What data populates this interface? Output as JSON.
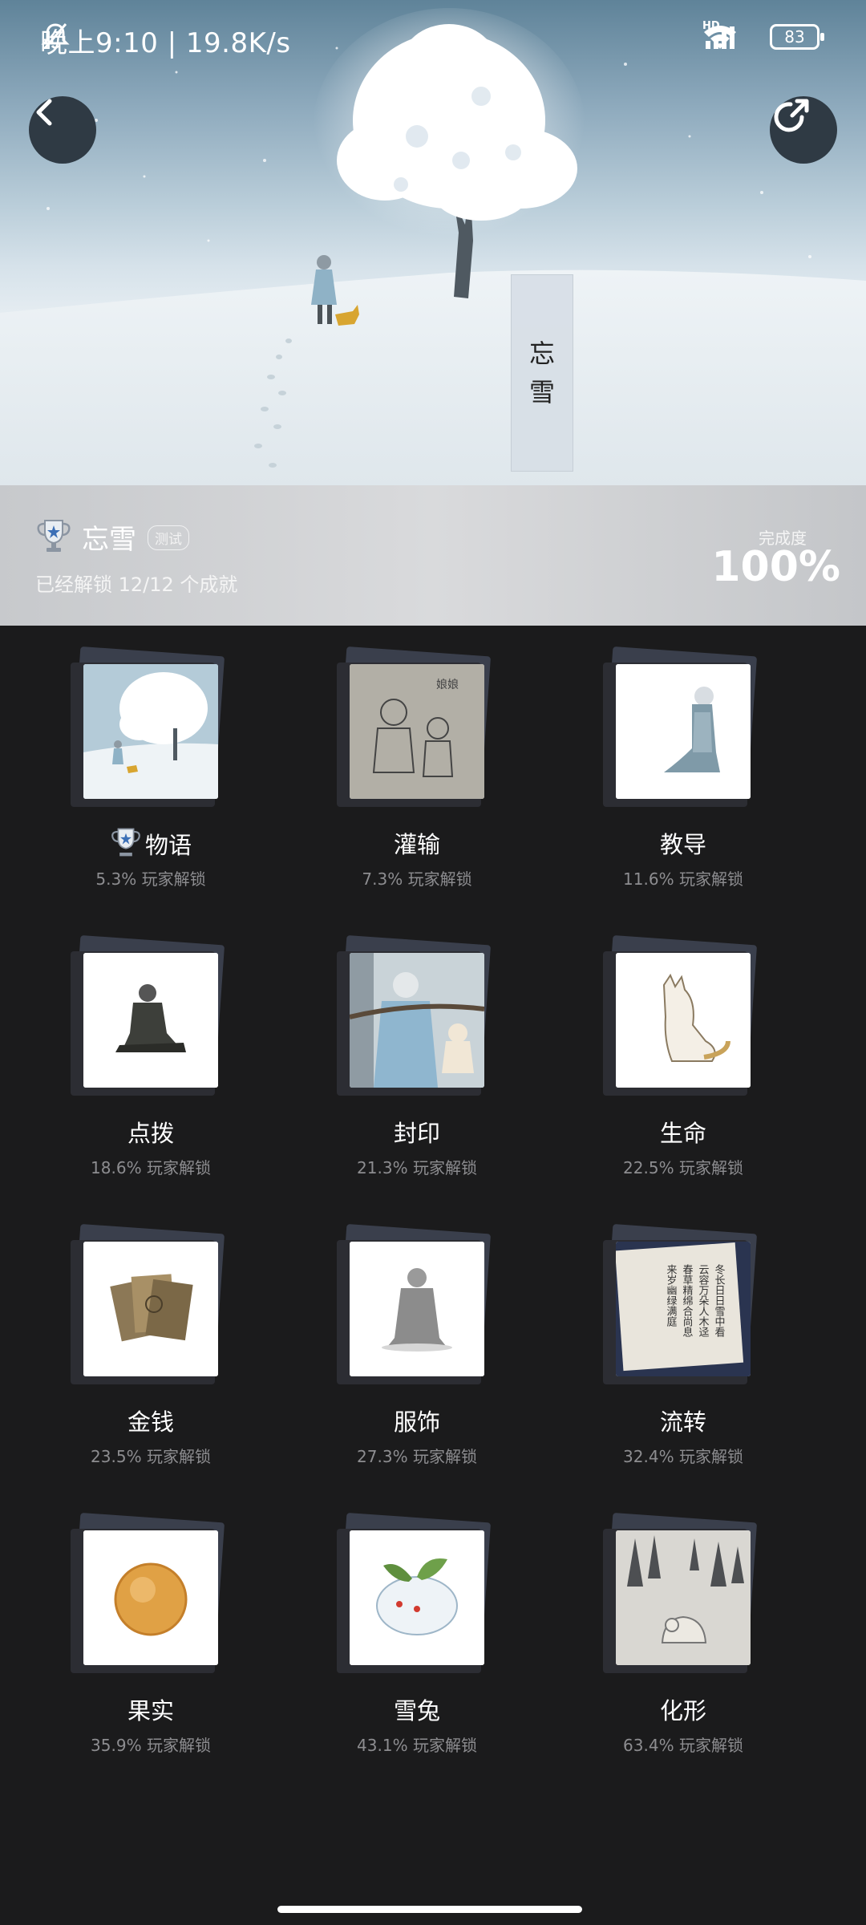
{
  "status_bar": {
    "time_speed": "晚上9:10 | 19.8K/s",
    "network_label": "HD",
    "battery": "83"
  },
  "hero": {
    "title_vertical": [
      "忘",
      "雪"
    ]
  },
  "info": {
    "title": "忘雪",
    "tag": "测试",
    "subtitle": "已经解锁 12/12 个成就",
    "progress_label": "完成度",
    "progress_value": "100%"
  },
  "achievements": [
    {
      "name": "物语",
      "rate": "5.3% 玩家解锁",
      "trophy": true
    },
    {
      "name": "灌输",
      "rate": "7.3% 玩家解锁"
    },
    {
      "name": "教导",
      "rate": "11.6% 玩家解锁"
    },
    {
      "name": "点拨",
      "rate": "18.6% 玩家解锁"
    },
    {
      "name": "封印",
      "rate": "21.3% 玩家解锁"
    },
    {
      "name": "生命",
      "rate": "22.5% 玩家解锁"
    },
    {
      "name": "金钱",
      "rate": "23.5% 玩家解锁"
    },
    {
      "name": "服饰",
      "rate": "27.3% 玩家解锁"
    },
    {
      "name": "流转",
      "rate": "32.4% 玩家解锁"
    },
    {
      "name": "果实",
      "rate": "35.9% 玩家解锁"
    },
    {
      "name": "雪兔",
      "rate": "43.1% 玩家解锁"
    },
    {
      "name": "化形",
      "rate": "63.4% 玩家解锁"
    }
  ],
  "art_texts": {
    "drawing_label": "娘娘",
    "poem_lines": [
      "冬长日日雪中看",
      "云容万朵人木迳",
      "春草精绵合尚息",
      "来岁幽绿满庭"
    ]
  }
}
